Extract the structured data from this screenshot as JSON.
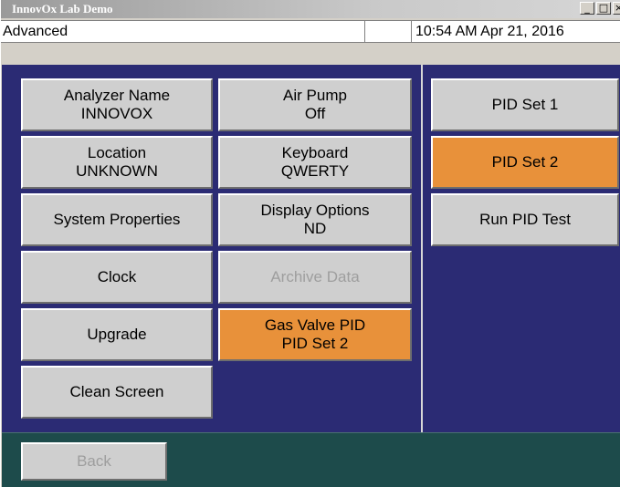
{
  "window": {
    "title": "InnovOx Lab Demo",
    "controls": {
      "minimize": "_",
      "maximize": "□",
      "close": "×"
    }
  },
  "status": {
    "page": "Advanced",
    "middle": "",
    "datetime": "10:54 AM Apr 21, 2016"
  },
  "left_buttons": {
    "analyzer_name": {
      "line1": "Analyzer Name",
      "line2": "INNOVOX"
    },
    "location": {
      "line1": "Location",
      "line2": "UNKNOWN"
    },
    "system_properties": {
      "line1": "System Properties"
    },
    "clock": {
      "line1": "Clock"
    },
    "upgrade": {
      "line1": "Upgrade"
    },
    "clean_screen": {
      "line1": "Clean Screen"
    }
  },
  "middle_buttons": {
    "air_pump": {
      "line1": "Air Pump",
      "line2": "Off"
    },
    "keyboard": {
      "line1": "Keyboard",
      "line2": "QWERTY"
    },
    "display_options": {
      "line1": "Display Options",
      "line2": "ND"
    },
    "archive_data": {
      "line1": "Archive Data",
      "state": "disabled"
    },
    "gas_valve_pid": {
      "line1": "Gas Valve PID",
      "line2": "PID Set 2",
      "state": "selected"
    }
  },
  "right_buttons": {
    "pid_set_1": {
      "label": "PID Set 1"
    },
    "pid_set_2": {
      "label": "PID Set 2",
      "state": "selected"
    },
    "run_pid_test": {
      "label": "Run PID Test"
    }
  },
  "footer": {
    "back": {
      "label": "Back",
      "state": "disabled"
    }
  },
  "colors": {
    "panel_bg": "#2b2b74",
    "footer_bg": "#1d4b4b",
    "button_bg": "#cfcfcf",
    "selected_bg": "#e8913a",
    "disabled_text": "#9e9e9e"
  }
}
